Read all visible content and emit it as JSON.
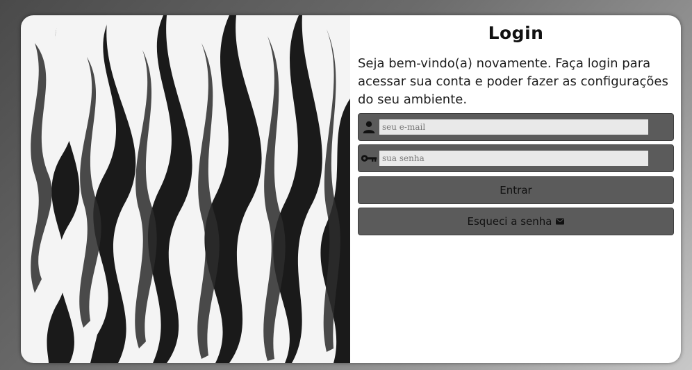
{
  "login": {
    "title": "Login",
    "welcome": "Seja bem-vindo(a) novamente. Faça login para acessar sua conta e poder fazer as configurações do seu ambiente.",
    "email_placeholder": "seu e-mail",
    "password_placeholder": "sua senha",
    "submit_label": "Entrar",
    "forgot_label": "Esqueci a senha"
  },
  "icons": {
    "email_field": "user-icon",
    "password_field": "key-icon",
    "forgot_button": "envelope-icon"
  },
  "colors": {
    "field_background": "#5b5b5b",
    "input_background": "#e9e9e9",
    "card_background": "#ffffff"
  }
}
